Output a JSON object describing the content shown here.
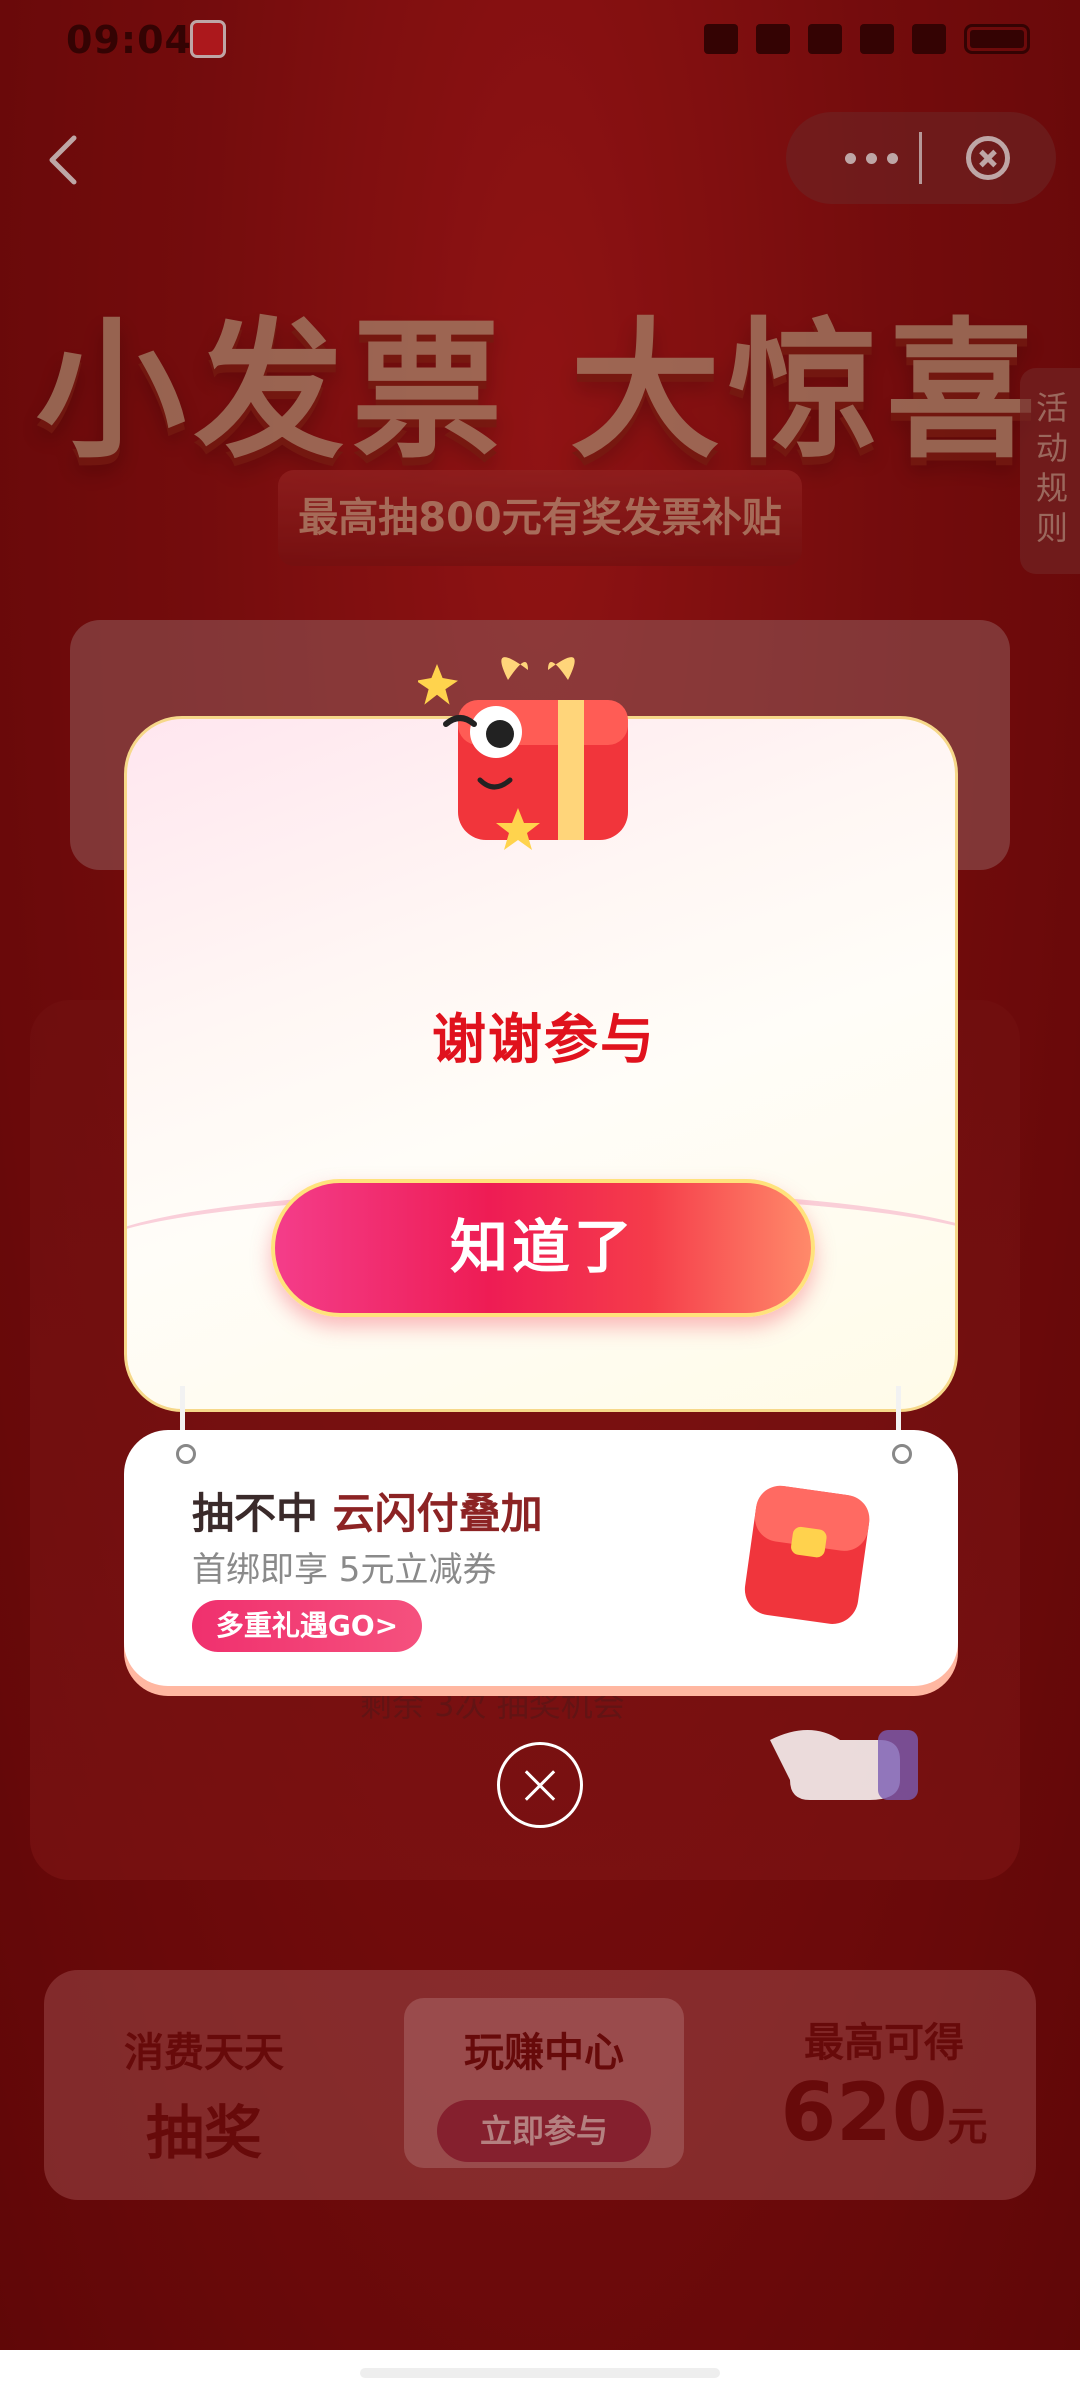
{
  "status_bar": {
    "time": "09:04"
  },
  "hero": {
    "title": "小发票 大惊喜",
    "subtitle": "最高抽800元有奖发票补贴",
    "rules_tab": "活动规则"
  },
  "background": {
    "machine_text": "剩余 3次 抽奖机会"
  },
  "bottom_banner": {
    "left_line1": "消费天天",
    "left_line2": "抽奖",
    "mid_title": "玩赚中心",
    "mid_button": "立即参与",
    "right_line1": "最高可得",
    "right_amount": "620",
    "right_unit": "元"
  },
  "modal": {
    "title": "谢谢参与",
    "button": "知道了"
  },
  "promo": {
    "heading_part1": "抽不中",
    "heading_accent": "云闪付叠加",
    "subtitle": "首绑即享 5元立减券",
    "button": "多重礼遇GO>"
  },
  "colors": {
    "brand_red": "#e0121d",
    "button_pink": "#ee1c54",
    "button_border": "#ffe27c",
    "promo_button": "#f0306e"
  },
  "icons": [
    "back-icon",
    "more-icon",
    "close-miniprogram-icon",
    "close-icon",
    "gift-mascot-icon",
    "red-envelope-icon",
    "pointing-hand-icon"
  ]
}
